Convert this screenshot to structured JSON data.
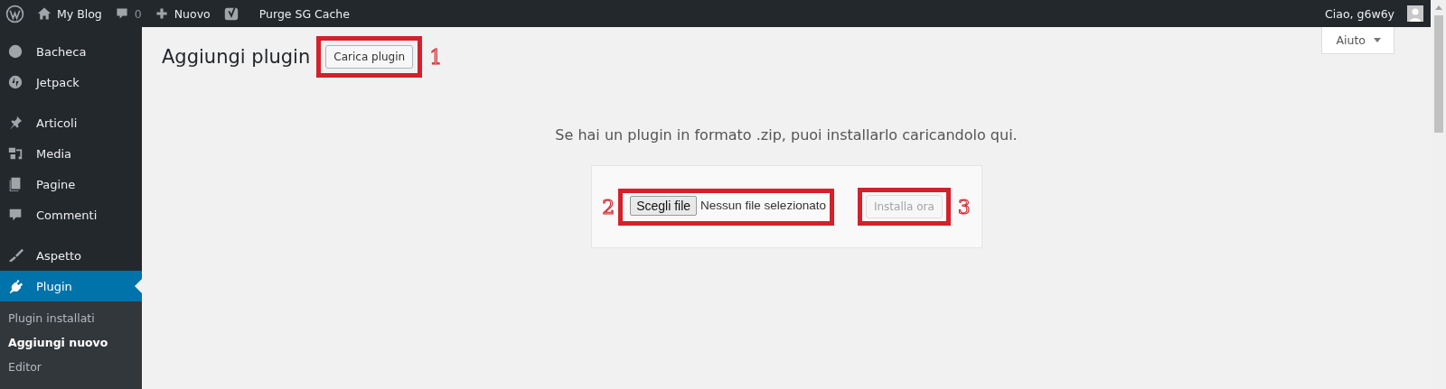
{
  "admin_bar": {
    "site": "My Blog",
    "comments": "0",
    "new": "Nuovo",
    "purge": "Purge SG Cache",
    "greeting": "Ciao, g6w6y"
  },
  "sidebar": {
    "groups": [
      [
        {
          "label": "Bacheca",
          "kind": "gauge",
          "selected": false
        },
        {
          "label": "Jetpack",
          "kind": "bolt",
          "selected": false
        }
      ],
      [
        {
          "label": "Articoli",
          "kind": "pin",
          "selected": false
        },
        {
          "label": "Media",
          "kind": "media",
          "selected": false
        },
        {
          "label": "Pagine",
          "kind": "pages",
          "selected": false
        },
        {
          "label": "Commenti",
          "kind": "comment",
          "selected": false
        }
      ],
      [
        {
          "label": "Aspetto",
          "kind": "brush",
          "selected": false
        },
        {
          "label": "Plugin",
          "kind": "plug",
          "selected": true
        }
      ]
    ],
    "submenu": [
      {
        "label": "Plugin installati",
        "selected": false
      },
      {
        "label": "Aggiungi nuovo",
        "selected": true
      },
      {
        "label": "Editor",
        "selected": false
      }
    ]
  },
  "help_tab": "Aiuto",
  "page": {
    "title": "Aggiungi plugin",
    "upload_button": "Carica plugin",
    "intro": "Se hai un plugin in formato .zip, puoi installarlo caricandolo qui.",
    "choose_file": "Scegli file",
    "no_file": "Nessun file selezionato",
    "install_button": {
      "label": "Installa ora",
      "disabled": true
    }
  },
  "annotations": [
    "1",
    "2",
    "3"
  ]
}
